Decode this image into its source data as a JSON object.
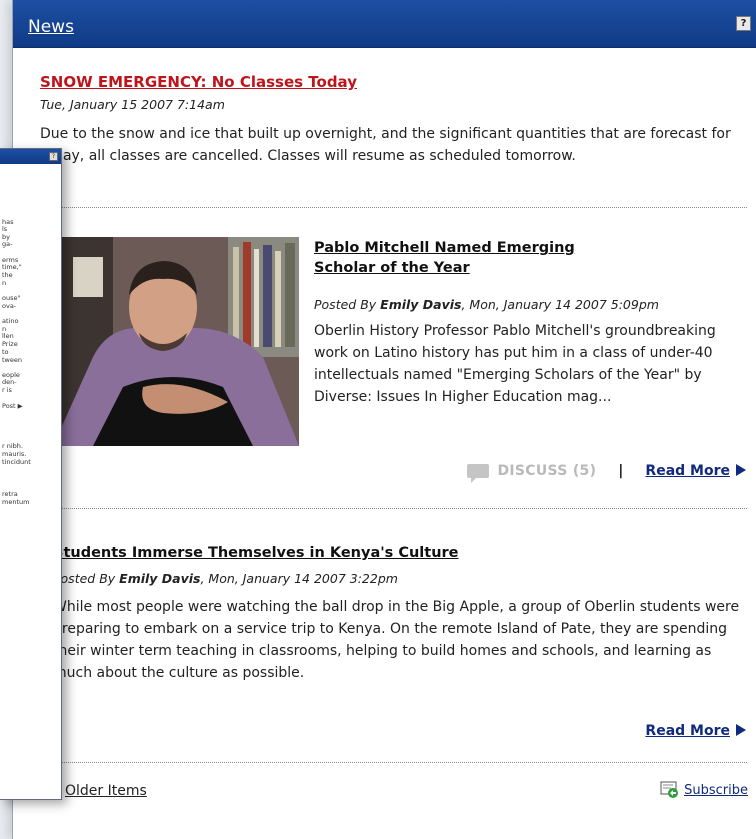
{
  "window": {
    "title": "News",
    "help_label": "?"
  },
  "item1": {
    "headline": "SNOW EMERGENCY: No Classes Today",
    "date": "Tue, January 15 2007  7:14am",
    "body": "Due to the snow and ice that built up overnight, and the significant quantities that are forecast for today, all classes are cancelled. Classes will resume as scheduled tomorrow."
  },
  "item2": {
    "headline": "Pablo Mitchell Named Emerging Scholar of the Year",
    "posted_by_prefix": "Posted By ",
    "author": "Emily Davis",
    "date": ", Mon, January 14 2007  5:09pm",
    "body": "Oberlin History Professor Pablo Mitchell's groundbreaking work on Latino history has put him in a class of under-40 intellectuals named \"Emerging Scholars of the Year\" by Diverse: Issues In  Higher Education mag...",
    "discuss_label": "DISCUSS (5)",
    "separator": "|",
    "read_more": "Read More"
  },
  "item3": {
    "headline": "Students Immerse Themselves in Kenya's Culture",
    "posted_by_prefix": "Posted By ",
    "author": "Emily Davis",
    "date": ", Mon, January 14 2007  3:22pm",
    "body": "While most people were watching the ball drop in the Big Apple, a group of Oberlin students were preparing to embark on a service trip to Kenya.  On the remote Island of Pate, they are spending their winter term teaching in classrooms, helping to build homes and schools, and learning as much about the culture as possible.",
    "read_more": "Read More"
  },
  "footer": {
    "older_items": "Older Items",
    "subscribe": "Subscribe"
  },
  "back_window": {
    "help_label": "?",
    "lines": [
      "has",
      "ls",
      "by",
      "ga-",
      "",
      "erms",
      "time,\"",
      "the",
      "n",
      "",
      "ouse\"",
      "ova-",
      "",
      "atino",
      "n",
      "llen",
      "Prize",
      "to",
      "tween",
      "",
      "eople",
      "den-",
      "r is",
      "",
      "Post ▶",
      "",
      "",
      "",
      "r nibh.",
      "mauris.",
      "tincidunt",
      "",
      "",
      "",
      "retra",
      "mentum"
    ]
  }
}
